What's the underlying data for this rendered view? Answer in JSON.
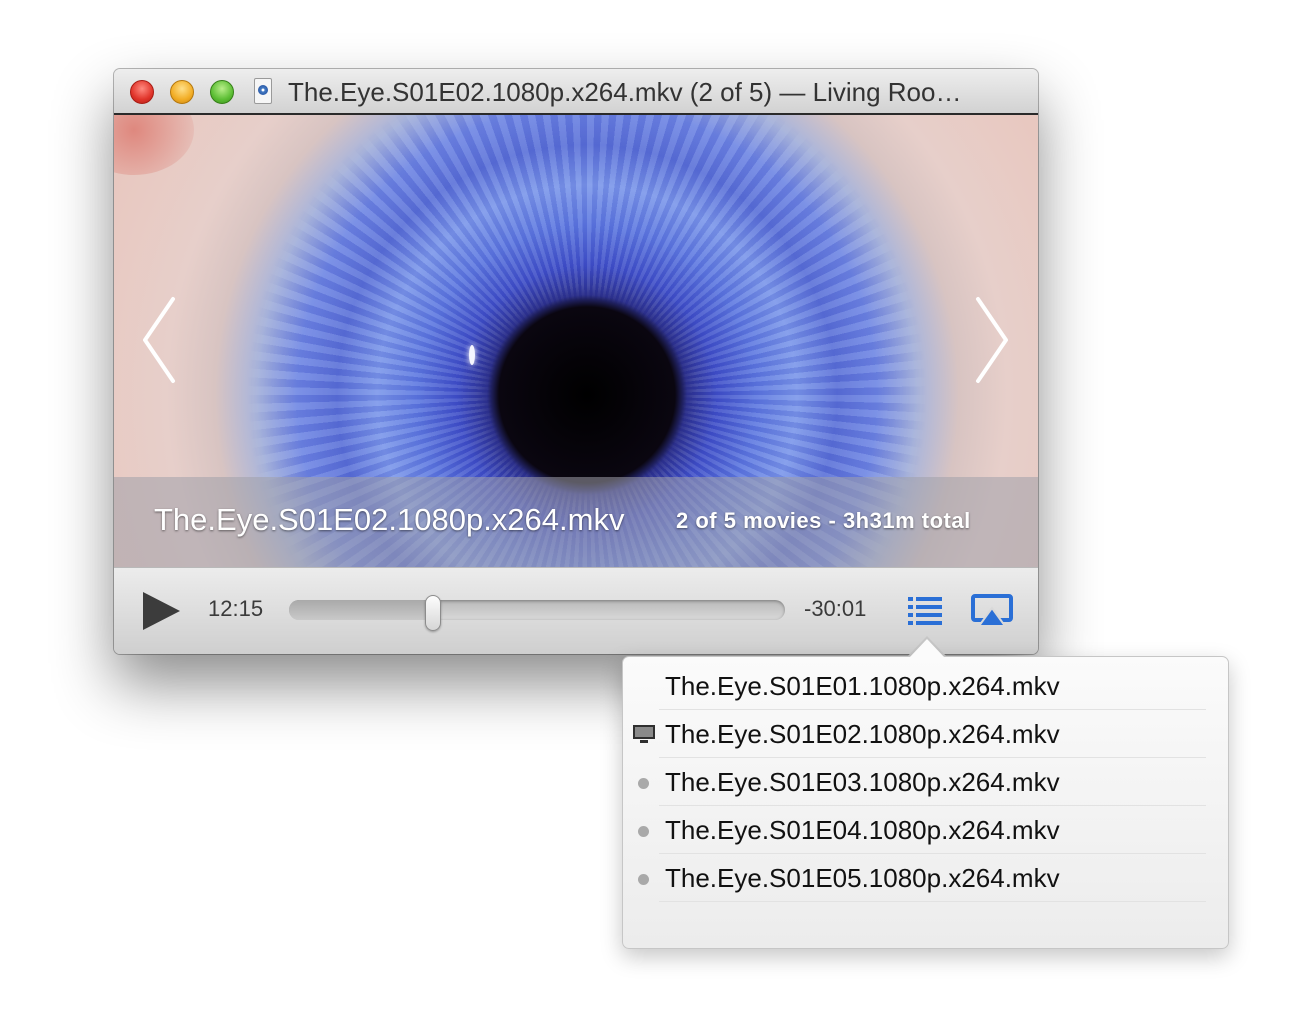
{
  "window": {
    "title": "The.Eye.S01E02.1080p.x264.mkv (2 of 5) — Living Roo…",
    "file_icon": "mkv-file-icon"
  },
  "video": {
    "caption_title": "The.Eye.S01E02.1080p.x264.mkv",
    "caption_info": "2 of 5 movies - 3h31m total",
    "prev_icon": "chevron-left-icon",
    "next_icon": "chevron-right-icon"
  },
  "controls": {
    "play_icon": "play-icon",
    "elapsed": "12:15",
    "remaining": "-30:01",
    "progress": 0.29,
    "playlist_icon": "list-icon",
    "airplay_icon": "airplay-icon",
    "accent_color": "#2a6fd6"
  },
  "playlist": {
    "items": [
      {
        "label": "The.Eye.S01E01.1080p.x264.mkv",
        "state": "watched"
      },
      {
        "label": "The.Eye.S01E02.1080p.x264.mkv",
        "state": "playing"
      },
      {
        "label": "The.Eye.S01E03.1080p.x264.mkv",
        "state": "unwatched"
      },
      {
        "label": "The.Eye.S01E04.1080p.x264.mkv",
        "state": "unwatched"
      },
      {
        "label": "The.Eye.S01E05.1080p.x264.mkv",
        "state": "unwatched"
      }
    ]
  }
}
